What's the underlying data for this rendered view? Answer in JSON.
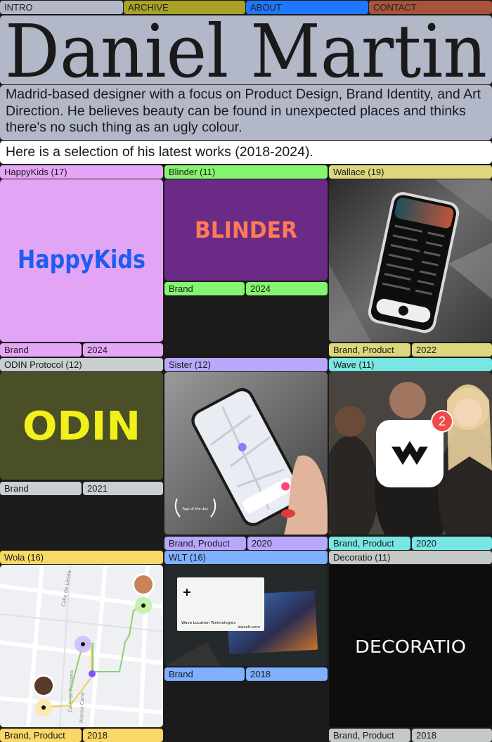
{
  "nav": [
    {
      "label": "INTRO",
      "color": "#b3b8c9"
    },
    {
      "label": "ARCHIVE",
      "color": "#a8a225"
    },
    {
      "label": "ABOUT",
      "color": "#1f77ff"
    },
    {
      "label": "CONTACT",
      "color": "#a8543c"
    }
  ],
  "hero": {
    "name": "Daniel Martin"
  },
  "bio": "Madrid-based designer with a focus on Product Design, Brand Identity, and Art Direction. He believes beauty can be found in unexpected places and thinks there's no such thing as an ugly colour.",
  "selection": "Here is a selection of his latest works (2018-2024).",
  "projects": [
    {
      "title": "HappyKids (17)",
      "category": "Brand",
      "year": "2024",
      "color": "#e6a6f7",
      "logo": "HappyKids"
    },
    {
      "title": "Blinder (11)",
      "category": "Brand",
      "year": "2024",
      "color": "#85f56f",
      "logo": "BLINDER"
    },
    {
      "title": "Wallace (19)",
      "category": "Brand, Product",
      "year": "2022",
      "color": "#dcd77c"
    },
    {
      "title": "ODIN Protocol (12)",
      "category": "Brand",
      "year": "2021",
      "color": "#c9cfd0",
      "logo": "ODIN"
    },
    {
      "title": "Sister (12)",
      "category": "Brand, Product",
      "year": "2020",
      "color": "#b8a7fb",
      "badge": "App of the day"
    },
    {
      "title": "Wave (11)",
      "category": "Brand, Product",
      "year": "2020",
      "color": "#78e6e2",
      "notif": "2"
    },
    {
      "title": "Wola (16)",
      "category": "Brand, Product",
      "year": "2018",
      "color": "#f9d868",
      "street1": "Calle de Lérida",
      "street2": "Calle de Ponzano",
      "street3": "Alonso Cano"
    },
    {
      "title": "WLT (16)",
      "category": "Brand",
      "year": "2018",
      "color": "#7fb0ff",
      "card_name": "Wave Location Technologies",
      "card_url": "wavelt.com"
    },
    {
      "title": "Decoratio (11)",
      "category": "Brand, Product",
      "year": "2018",
      "color": "#c4c8c6",
      "logo": "DECORATIO"
    }
  ]
}
